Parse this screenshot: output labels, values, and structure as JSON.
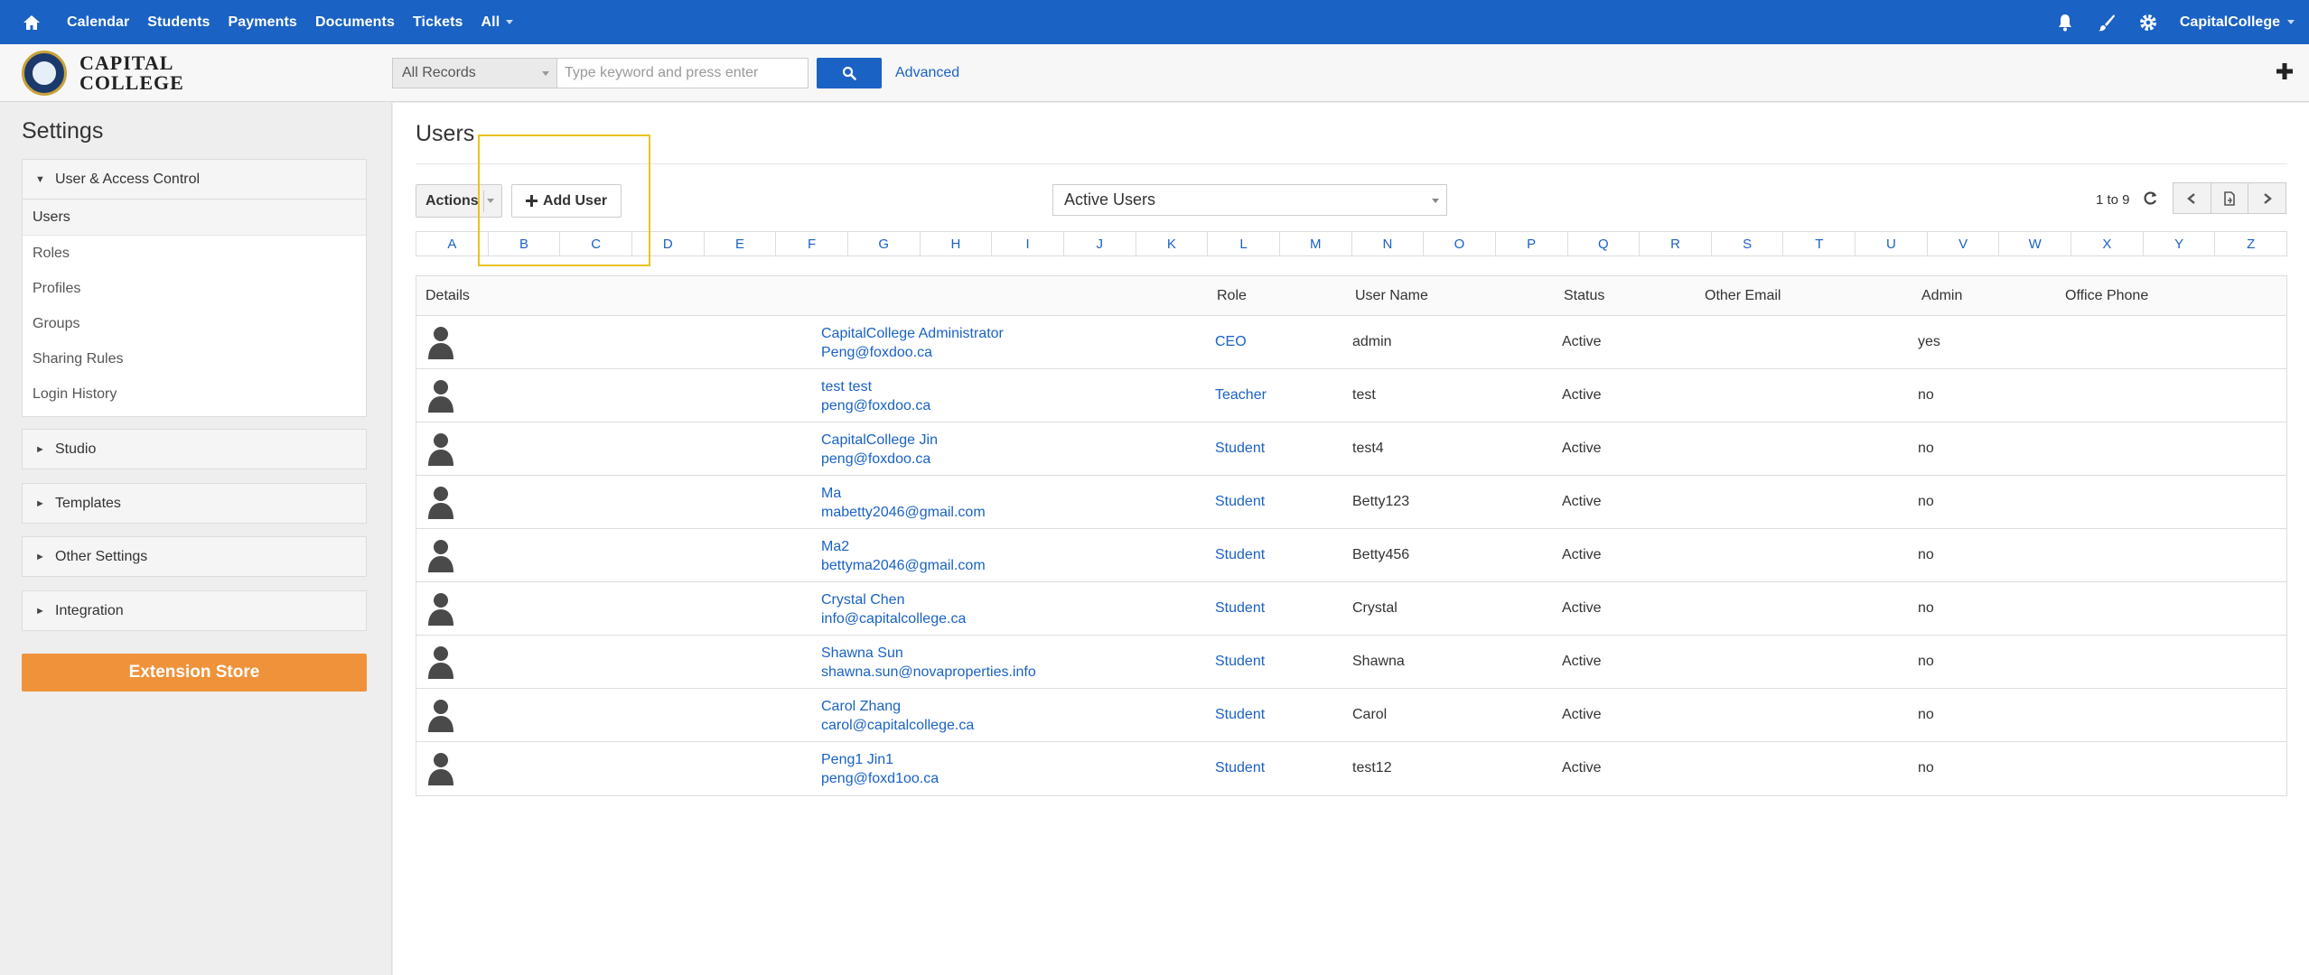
{
  "topnav": {
    "items": [
      "Calendar",
      "Students",
      "Payments",
      "Documents",
      "Tickets"
    ],
    "all_label": "All",
    "org_name": "CapitalCollege"
  },
  "header": {
    "logo_line1": "CAPITAL",
    "logo_line2": "COLLEGE",
    "record_select": "All Records",
    "search_placeholder": "Type keyword and press enter",
    "advanced_label": "Advanced"
  },
  "sidebar": {
    "title": "Settings",
    "sections": {
      "user_access": "User & Access Control",
      "studio": "Studio",
      "templates": "Templates",
      "other_settings": "Other Settings",
      "integration": "Integration"
    },
    "items": [
      "Users",
      "Roles",
      "Profiles",
      "Groups",
      "Sharing Rules",
      "Login History"
    ],
    "extension_store": "Extension Store"
  },
  "main": {
    "title": "Users",
    "actions_label": "Actions",
    "add_user_label": "Add User",
    "filter_value": "Active Users",
    "pager_text": "1 to 9",
    "alphabet": [
      "A",
      "B",
      "C",
      "D",
      "E",
      "F",
      "G",
      "H",
      "I",
      "J",
      "K",
      "L",
      "M",
      "N",
      "O",
      "P",
      "Q",
      "R",
      "S",
      "T",
      "U",
      "V",
      "W",
      "X",
      "Y",
      "Z"
    ],
    "columns": {
      "details": "Details",
      "role": "Role",
      "user_name": "User Name",
      "status": "Status",
      "other_email": "Other Email",
      "admin": "Admin",
      "office_phone": "Office Phone"
    },
    "rows": [
      {
        "name": "CapitalCollege Administrator",
        "email": "Peng@foxdoo.ca",
        "role": "CEO",
        "user_name": "admin",
        "status": "Active",
        "admin": "yes"
      },
      {
        "name": "test test",
        "email": "peng@foxdoo.ca",
        "role": "Teacher",
        "user_name": "test",
        "status": "Active",
        "admin": "no"
      },
      {
        "name": "CapitalCollege Jin",
        "email": "peng@foxdoo.ca",
        "role": "Student",
        "user_name": "test4",
        "status": "Active",
        "admin": "no"
      },
      {
        "name": "Ma",
        "email": "mabetty2046@gmail.com",
        "role": "Student",
        "user_name": "Betty123",
        "status": "Active",
        "admin": "no"
      },
      {
        "name": "Ma2",
        "email": "bettyma2046@gmail.com",
        "role": "Student",
        "user_name": "Betty456",
        "status": "Active",
        "admin": "no"
      },
      {
        "name": "Crystal Chen",
        "email": "info@capitalcollege.ca",
        "role": "Student",
        "user_name": "Crystal",
        "status": "Active",
        "admin": "no"
      },
      {
        "name": "Shawna Sun",
        "email": "shawna.sun@novaproperties.info",
        "role": "Student",
        "user_name": "Shawna",
        "status": "Active",
        "admin": "no"
      },
      {
        "name": "Carol Zhang",
        "email": "carol@capitalcollege.ca",
        "role": "Student",
        "user_name": "Carol",
        "status": "Active",
        "admin": "no"
      },
      {
        "name": "Peng1 Jin1",
        "email": "peng@foxd1oo.ca",
        "role": "Student",
        "user_name": "test12",
        "status": "Active",
        "admin": "no"
      }
    ]
  },
  "colors": {
    "brand_blue": "#1a62c4",
    "extension_orange": "#f0923a",
    "highlight_yellow": "#e8c41a"
  }
}
